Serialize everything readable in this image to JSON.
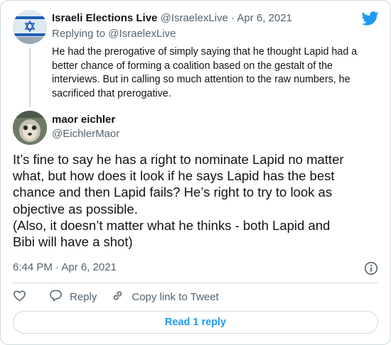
{
  "parent_tweet": {
    "name": "Israeli Elections Live",
    "handle": "@IsraelexLive",
    "separator": "·",
    "date": "Apr 6, 2021",
    "replying_to_prefix": "Replying to",
    "replying_to_handle": "@IsraelexLive",
    "text": "He had the prerogative of simply saying that he thought Lapid had a better chance of forming a coalition based on the gestalt of the interviews. But in calling so much attention to the raw numbers, he sacrificed that prerogative."
  },
  "main_tweet": {
    "name": "maor eichler",
    "handle": "@EichlerMaor",
    "text_lines": [
      "It’s fine to say he has a right to nominate Lapid no matter",
      "what, but how does it look if he says Lapid has the best",
      "chance and then Lapid fails? He’s right to try to look as",
      "objective as possible.",
      "(Also, it doesn’t matter what he thinks - both Lapid and",
      "Bibi will have a shot)"
    ],
    "timestamp": "6:44 PM · Apr 6, 2021"
  },
  "actions": {
    "reply_label": "Reply",
    "copy_link_label": "Copy link to Tweet",
    "read_replies_label": "Read 1 reply"
  },
  "icons": {
    "brand": "twitter-bird-icon",
    "like": "heart-icon",
    "reply": "speech-bubble-icon",
    "copy": "link-icon",
    "info": "info-icon"
  },
  "colors": {
    "accent": "#1d9bf0",
    "muted_text": "#536471",
    "border": "#cfd9de"
  }
}
